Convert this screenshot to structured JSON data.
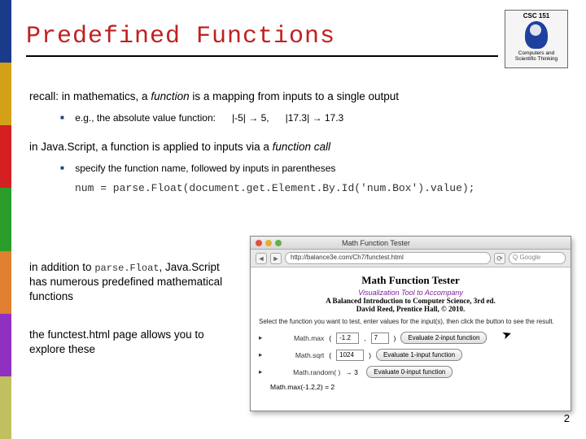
{
  "logo": {
    "course": "CSC 151",
    "sub": "Computers and Scientific Thinking"
  },
  "title": "Predefined Functions",
  "body": {
    "p1a": "recall: in mathematics, a ",
    "p1b": "function",
    "p1c": " is a mapping from inputs to a single output",
    "b1a": "e.g., the absolute value function:",
    "b1b": "|-5| → 5,",
    "b1c": "|17.3| → 17.3",
    "p2a": "in Java.Script, a function is applied to inputs via a ",
    "p2b": "function call",
    "b2": "specify the function name, followed by inputs in parentheses",
    "code": "num = parse.Float(document.get.Element.By.Id('num.Box').value);",
    "p3": "in addition to parse.Float, Java.Script has numerous predefined mathematical functions",
    "p4": "the functest.html page allows you to explore these"
  },
  "browser": {
    "windowTitle": "Math Function Tester",
    "url": "http://balance3e.com/Ch7/functest.html",
    "searchPlaceholder": "Google",
    "h1": "Math Function Tester",
    "sub1": "Visualization Tool to Accompany",
    "sub2": "A Balanced Introduction to Computer Science, 3rd ed.",
    "sub3": "David Reed, Prentice Hall, © 2010.",
    "instr": "Select the function you want to test, enter values for the input(s), then click the button to see the result.",
    "rows": [
      {
        "label": "Math.max",
        "p": "(",
        "a": "-1.2",
        "comma": ",",
        "b": "7",
        "close": ")",
        "btn": "Evaluate 2-input function"
      },
      {
        "label": "Math.sqrt",
        "p": "(",
        "a": "1024",
        "close": ")",
        "btn": "Evaluate 1-input function"
      },
      {
        "label": "Math.random( )",
        "btn": "Evaluate 0-input function"
      }
    ],
    "result": "Math.max(-1.2,2) = 2"
  },
  "pageNumber": "2"
}
